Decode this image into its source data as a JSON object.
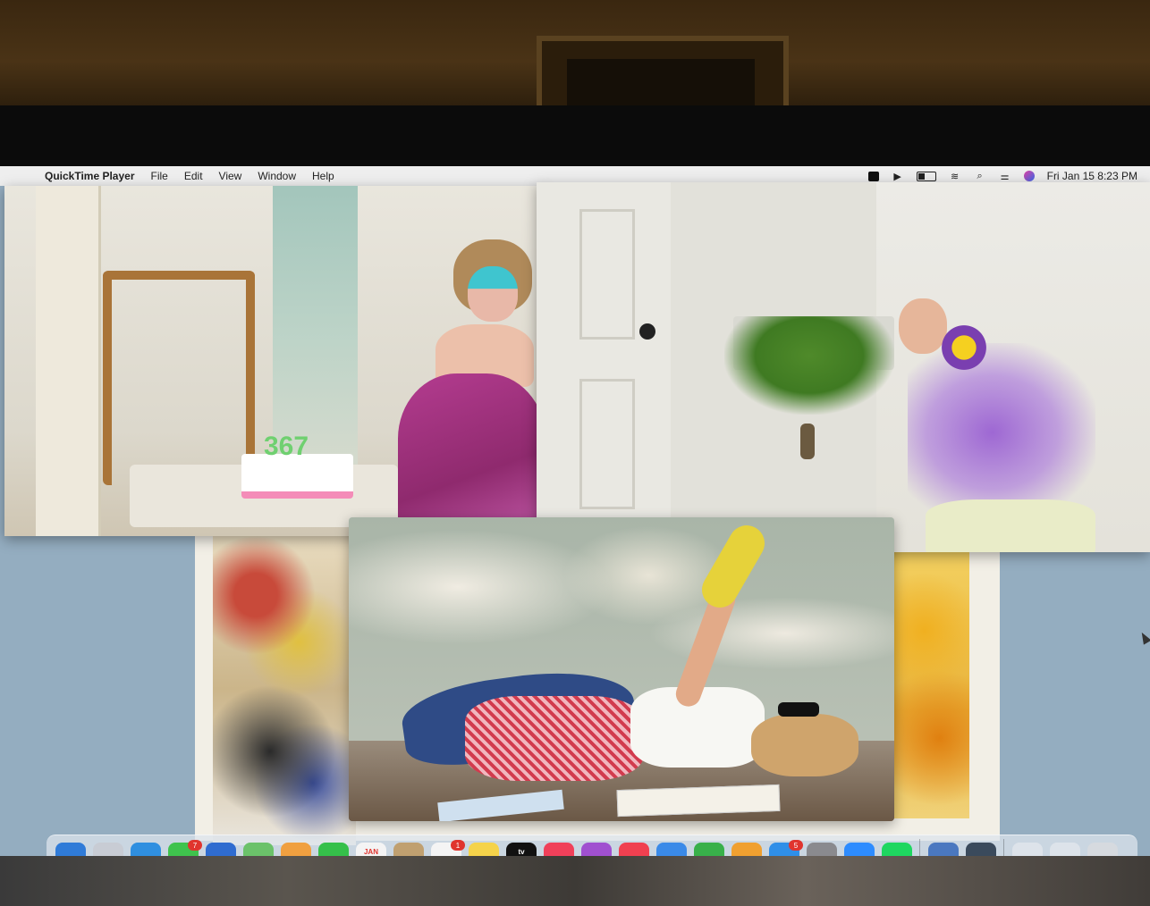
{
  "menubar": {
    "app_name": "QuickTime Player",
    "menus": [
      "File",
      "Edit",
      "View",
      "Window",
      "Help"
    ],
    "clock": "Fri Jan 15  8:23 PM"
  },
  "photo_1": {
    "cake_number": "367"
  },
  "dock": {
    "items": [
      {
        "name": "finder",
        "color": "#2f7bd8"
      },
      {
        "name": "launchpad",
        "color": "#c8ccd4"
      },
      {
        "name": "safari",
        "color": "#2f8fe0"
      },
      {
        "name": "messages",
        "color": "#3fc34d",
        "badge": "7"
      },
      {
        "name": "mail",
        "color": "#2f6cd0"
      },
      {
        "name": "maps",
        "color": "#6bc26a"
      },
      {
        "name": "photos",
        "color": "#f0a040"
      },
      {
        "name": "facetime",
        "color": "#35c04a"
      },
      {
        "name": "calendar",
        "color": "#f4f4f4",
        "label": "JAN"
      },
      {
        "name": "contacts",
        "color": "#c0a070"
      },
      {
        "name": "reminders",
        "color": "#f4f4f4",
        "badge": "1"
      },
      {
        "name": "notes",
        "color": "#f5d34a"
      },
      {
        "name": "tv",
        "color": "#111111",
        "label": "tv"
      },
      {
        "name": "music",
        "color": "#f0405a"
      },
      {
        "name": "podcasts",
        "color": "#a050d0"
      },
      {
        "name": "news",
        "color": "#f04050"
      },
      {
        "name": "keynote",
        "color": "#3a8ae8"
      },
      {
        "name": "numbers",
        "color": "#38b04a"
      },
      {
        "name": "pages",
        "color": "#f0a030"
      },
      {
        "name": "app-store",
        "color": "#2f8fe8",
        "badge": "5"
      },
      {
        "name": "system-preferences",
        "color": "#8a8a8e"
      },
      {
        "name": "zoom",
        "color": "#2d8cff"
      },
      {
        "name": "spotify",
        "color": "#1ed760"
      },
      {
        "name": "preview",
        "color": "#4a78c0"
      },
      {
        "name": "quicktime",
        "color": "#3a4a5c"
      },
      {
        "name": "downloads-stack",
        "color": "#dde3ea"
      },
      {
        "name": "documents-stack",
        "color": "#dde3ea"
      },
      {
        "name": "trash",
        "color": "#d6dadf"
      }
    ]
  }
}
